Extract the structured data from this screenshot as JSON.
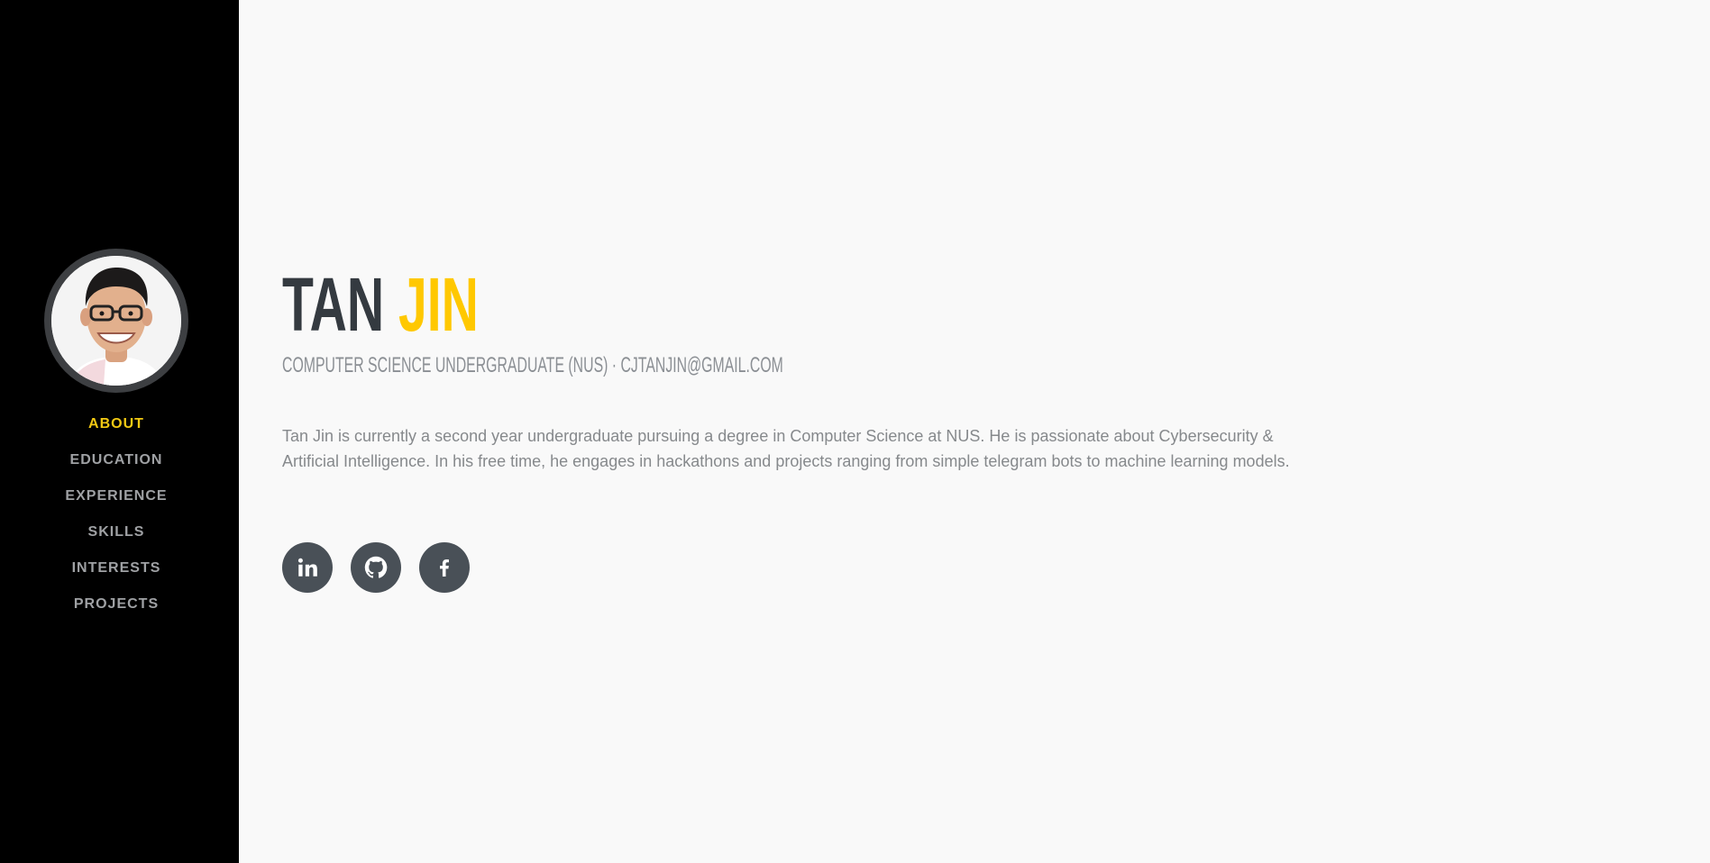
{
  "sidebar": {
    "avatar": "profile-photo",
    "nav": [
      {
        "label": "ABOUT",
        "active": true
      },
      {
        "label": "EDUCATION",
        "active": false
      },
      {
        "label": "EXPERIENCE",
        "active": false
      },
      {
        "label": "SKILLS",
        "active": false
      },
      {
        "label": "INTERESTS",
        "active": false
      },
      {
        "label": "PROJECTS",
        "active": false
      }
    ]
  },
  "about": {
    "first_name": "TAN",
    "last_name": "JIN",
    "subheading": "COMPUTER SCIENCE UNDERGRADUATE (NUS) · CJTANJIN@GMAIL.COM",
    "bio": "Tan Jin is currently a second year undergraduate pursuing a degree in Computer Science at NUS. He is passionate about Cybersecurity & Artificial Intelligence. In his free time, he engages in hackathons and projects ranging from simple telegram bots to machine learning models.",
    "socials": [
      {
        "icon": "linkedin-icon"
      },
      {
        "icon": "github-icon"
      },
      {
        "icon": "facebook-icon"
      }
    ]
  },
  "colors": {
    "accent": "#ffc800",
    "sidebar_bg": "#000000",
    "page_bg": "#f9f9f9",
    "social_bg": "#495057"
  }
}
